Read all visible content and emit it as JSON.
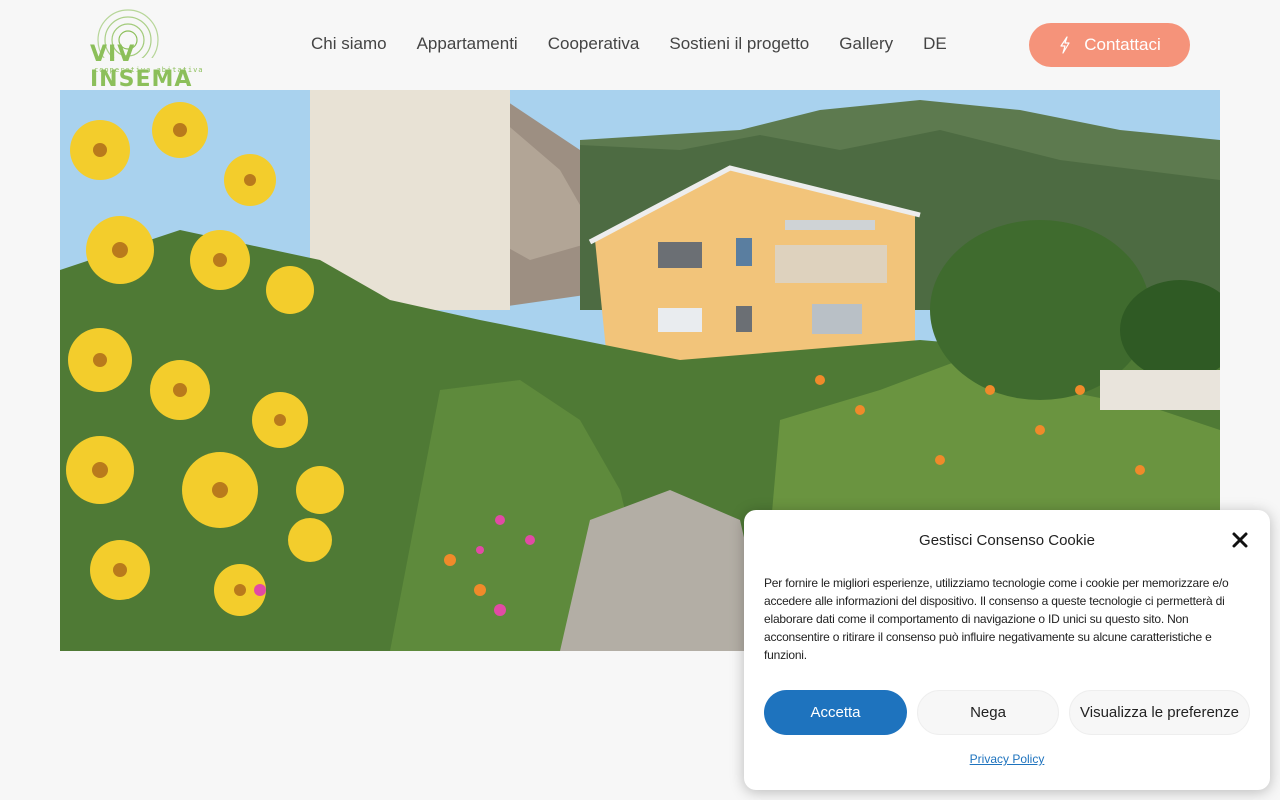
{
  "logo": {
    "name": "VIV INSEMA",
    "tagline": "cooperativa abitativa"
  },
  "nav": {
    "items": [
      "Chi siamo",
      "Appartamenti",
      "Cooperativa",
      "Sostieni il progetto",
      "Gallery",
      "DE"
    ]
  },
  "contact": {
    "label": "Contattaci",
    "icon": "bolt-icon"
  },
  "cookie": {
    "title": "Gestisci Consenso Cookie",
    "text": "Per fornire le migliori esperienze, utilizziamo tecnologie come i cookie per memorizzare e/o accedere alle informazioni del dispositivo. Il consenso a queste tecnologie ci permetterà di elaborare dati come il comportamento di navigazione o ID unici su questo sito. Non acconsentire o ritirare il consenso può influire negativamente su alcune caratteristiche e funzioni.",
    "accept": "Accetta",
    "deny": "Nega",
    "preferences": "Visualizza le preferenze",
    "privacy": "Privacy Policy"
  },
  "colors": {
    "accent": "#f5937a",
    "primary": "#1e73be",
    "logo": "#8cbf5a"
  }
}
